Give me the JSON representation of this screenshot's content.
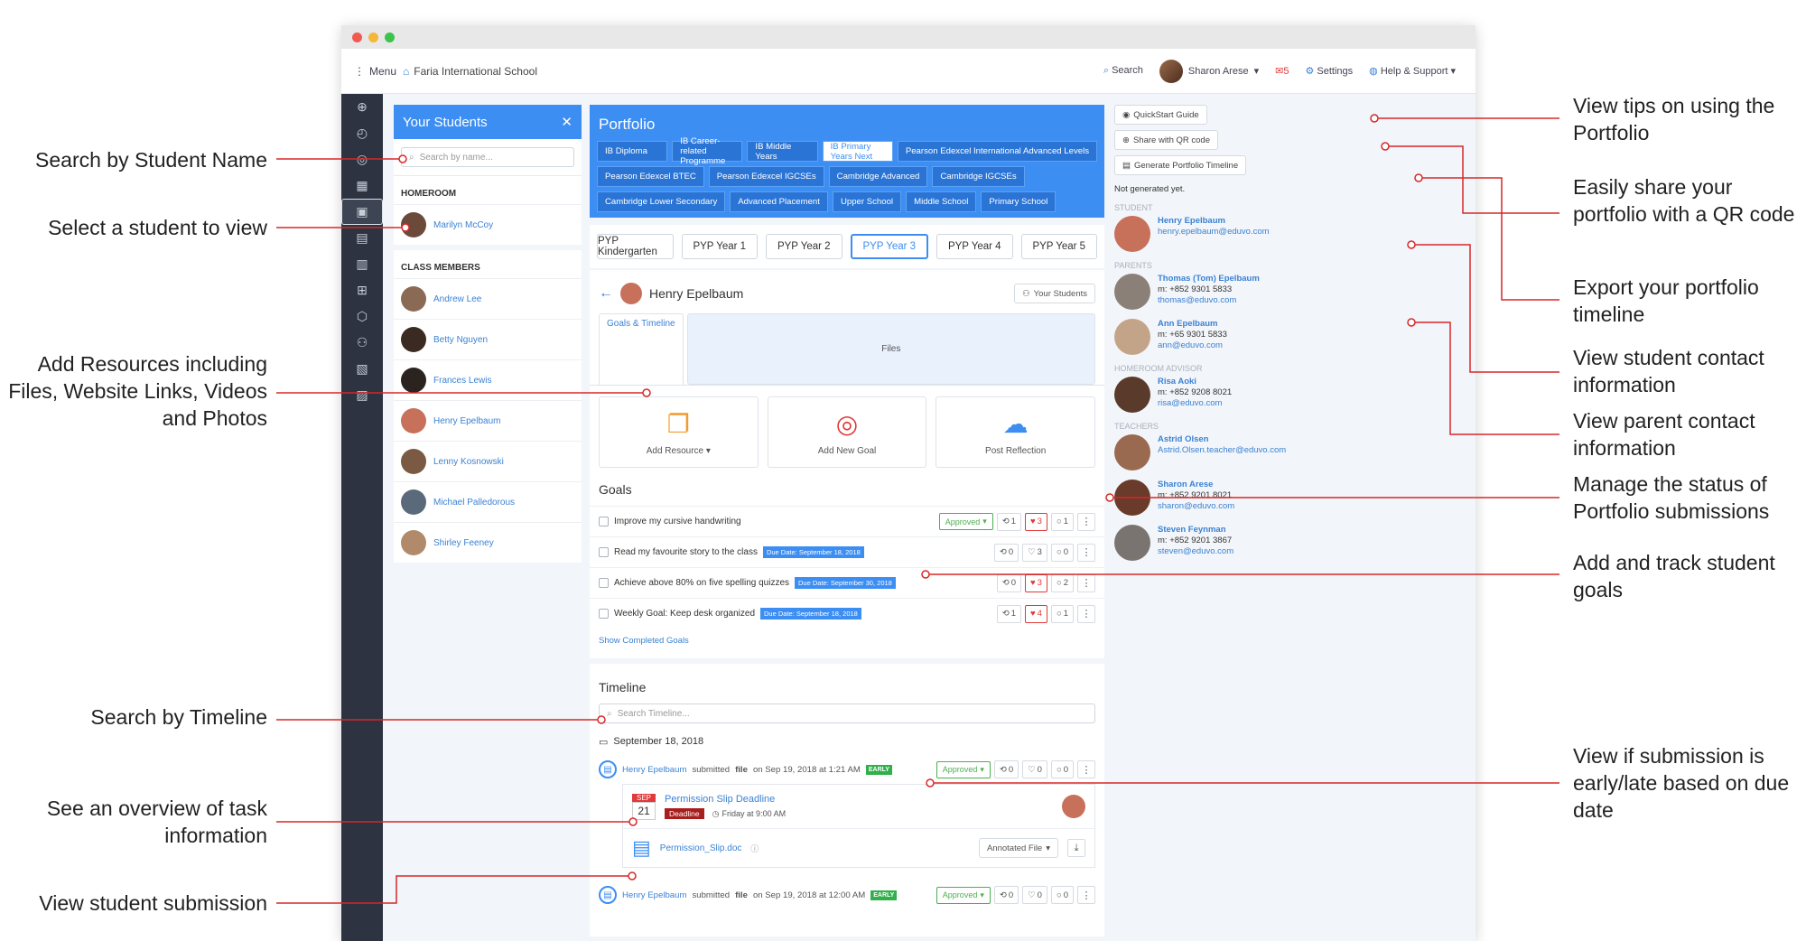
{
  "annotations_left": {
    "search_name": "Search by Student Name",
    "select_student": "Select a student to view",
    "add_resources": "Add Resources including Files, Website Links, Videos and Photos",
    "search_timeline": "Search by Timeline",
    "task_overview": "See an overview of task information",
    "view_submission": "View student submission"
  },
  "annotations_right": {
    "tips": "View tips on using the Portfolio",
    "qr": "Easily share your portfolio with a QR code",
    "export": "Export your portfolio timeline",
    "student_contact": "View student contact information",
    "parent_contact": "View parent contact information",
    "status": "Manage the status of Portfolio submissions",
    "goals": "Add and track student goals",
    "early_late": "View if submission is early/late based on due date"
  },
  "topnav": {
    "menu": "Menu",
    "school": "Faria International School",
    "search": "Search",
    "user": "Sharon Arese",
    "mail_count": "5",
    "settings": "Settings",
    "help": "Help & Support"
  },
  "students_panel": {
    "title": "Your Students",
    "search_placeholder": "Search by name...",
    "homeroom_label": "HOMEROOM",
    "homeroom": [
      {
        "name": "Marilyn McCoy",
        "color": "#6b4a3a"
      }
    ],
    "members_label": "CLASS MEMBERS",
    "members": [
      {
        "name": "Andrew Lee",
        "color": "#8a6a55"
      },
      {
        "name": "Betty Nguyen",
        "color": "#3a2a22"
      },
      {
        "name": "Frances Lewis",
        "color": "#2a2320"
      },
      {
        "name": "Henry Epelbaum",
        "color": "#c7705a"
      },
      {
        "name": "Lenny Kosnowski",
        "color": "#7a5a42"
      },
      {
        "name": "Michael Palledorous",
        "color": "#5a6a7a"
      },
      {
        "name": "Shirley Feeney",
        "color": "#b08a6a"
      }
    ]
  },
  "portfolio": {
    "title": "Portfolio",
    "programmes": [
      "IB Diploma",
      "IB Career-related Programme",
      "IB Middle Years",
      "IB Primary Years Next",
      "Pearson Edexcel International Advanced Levels",
      "Pearson Edexcel BTEC",
      "Pearson Edexcel IGCSEs",
      "Cambridge Advanced",
      "Cambridge IGCSEs",
      "Cambridge Lower Secondary",
      "Advanced Placement",
      "Upper School",
      "Middle School",
      "Primary School"
    ],
    "years": [
      "PYP Kindergarten",
      "PYP Year 1",
      "PYP Year 2",
      "PYP Year 3",
      "PYP Year 4",
      "PYP Year 5"
    ],
    "student_name": "Henry Epelbaum",
    "your_students_btn": "Your Students",
    "tabs": [
      "Goals & Timeline",
      "Files"
    ],
    "actions": [
      "Add Resource",
      "Add New Goal",
      "Post Reflection"
    ],
    "goals_title": "Goals",
    "goals": [
      {
        "text": "Improve my cursive handwriting",
        "due": "",
        "approved": "Approved",
        "shares": "1",
        "likes": "3",
        "comments": "1",
        "liked": true
      },
      {
        "text": "Read my favourite story to the class",
        "due": "Due Date: September 18, 2018",
        "approved": "",
        "shares": "0",
        "likes": "3",
        "comments": "0",
        "liked": false
      },
      {
        "text": "Achieve above 80% on five spelling quizzes",
        "due": "Due Date: September 30, 2018",
        "approved": "",
        "shares": "0",
        "likes": "3",
        "comments": "2",
        "liked": true
      },
      {
        "text": "Weekly Goal: Keep desk organized",
        "due": "Due Date: September 18, 2018",
        "approved": "",
        "shares": "1",
        "likes": "4",
        "comments": "1",
        "liked": true
      }
    ],
    "show_completed": "Show Completed Goals",
    "timeline_title": "Timeline",
    "timeline_placeholder": "Search Timeline...",
    "timeline_date": "September 18, 2018",
    "entry1": {
      "name": "Henry Epelbaum",
      "verb": "submitted",
      "type": "file",
      "when": "on Sep 19, 2018 at 1:21 AM",
      "badge": "EARLY",
      "approved": "Approved",
      "shares": "0",
      "likes": "0",
      "comments": "0"
    },
    "task": {
      "month": "SEP",
      "day": "21",
      "title": "Permission Slip Deadline",
      "tag": "Deadline",
      "time": "Friday at 9:00 AM",
      "file": "Permission_Slip.doc",
      "file_btn": "Annotated File"
    },
    "entry2": {
      "name": "Henry Epelbaum",
      "verb": "submitted",
      "type": "file",
      "when": "on Sep 19, 2018 at 12:00 AM",
      "badge": "EARLY",
      "approved": "Approved",
      "shares": "0",
      "likes": "0",
      "comments": "0"
    }
  },
  "right_panel": {
    "quickstart": "QuickStart Guide",
    "qr": "Share with QR code",
    "generate": "Generate Portfolio Timeline",
    "not_generated": "Not generated yet.",
    "student_label": "STUDENT",
    "student": {
      "name": "Henry Epelbaum",
      "email": "henry.epelbaum@eduvo.com",
      "color": "#c7705a"
    },
    "parents_label": "PARENTS",
    "parents": [
      {
        "name": "Thomas (Tom) Epelbaum",
        "phone": "m: +852 9301 5833",
        "email": "thomas@eduvo.com",
        "color": "#8a8078"
      },
      {
        "name": "Ann Epelbaum",
        "phone": "m: +65 9301 5833",
        "email": "ann@eduvo.com",
        "color": "#c4a488"
      }
    ],
    "advisor_label": "HOMEROOM ADVISOR",
    "advisor": {
      "name": "Risa Aoki",
      "phone": "m: +852 9208 8021",
      "email": "risa@eduvo.com",
      "color": "#5a3a2a"
    },
    "teachers_label": "TEACHERS",
    "teachers": [
      {
        "name": "Astrid Olsen",
        "phone": "",
        "email": "Astrid.Olsen.teacher@eduvo.com",
        "color": "#9a6a50"
      },
      {
        "name": "Sharon Arese",
        "phone": "m: +852 9201 8021",
        "email": "sharon@eduvo.com",
        "color": "#6a3a2a"
      },
      {
        "name": "Steven Feynman",
        "phone": "m: +852 9201 3867",
        "email": "steven@eduvo.com",
        "color": "#7a7470"
      }
    ]
  },
  "colors": {
    "accent": "#3d8ef2",
    "sidebar": "#2d3340",
    "annotation_line": "#d62828"
  }
}
